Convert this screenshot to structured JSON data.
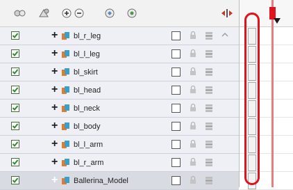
{
  "colors": {
    "checkbox_green": "#2e8b2e",
    "layer_icon_orange": "#e8782a",
    "layer_icon_teal": "#3aa0c8",
    "playhead_red": "#e0141c",
    "highlight_red": "#e2121a",
    "selected_row": "#d9dbe3"
  },
  "toolbar": {
    "icons": [
      "add-drawing-layer-icon",
      "add-peg-layer-icon",
      "add-remove-layer-icon",
      "layer-properties-icon",
      "motion-keyframe-icon",
      "timeline-zoom-icon"
    ]
  },
  "layers": [
    {
      "name": "bl_r_leg",
      "checked": true,
      "selected": false
    },
    {
      "name": "bl_l_leg",
      "checked": true,
      "selected": false
    },
    {
      "name": "bl_skirt",
      "checked": true,
      "selected": false
    },
    {
      "name": "bl_head",
      "checked": true,
      "selected": false
    },
    {
      "name": "bl_neck",
      "checked": true,
      "selected": false
    },
    {
      "name": "bl_body",
      "checked": true,
      "selected": false
    },
    {
      "name": "bl_l_arm",
      "checked": true,
      "selected": false
    },
    {
      "name": "bl_r_arm",
      "checked": true,
      "selected": false
    },
    {
      "name": "Ballerina_Model",
      "checked": true,
      "selected": true
    }
  ]
}
